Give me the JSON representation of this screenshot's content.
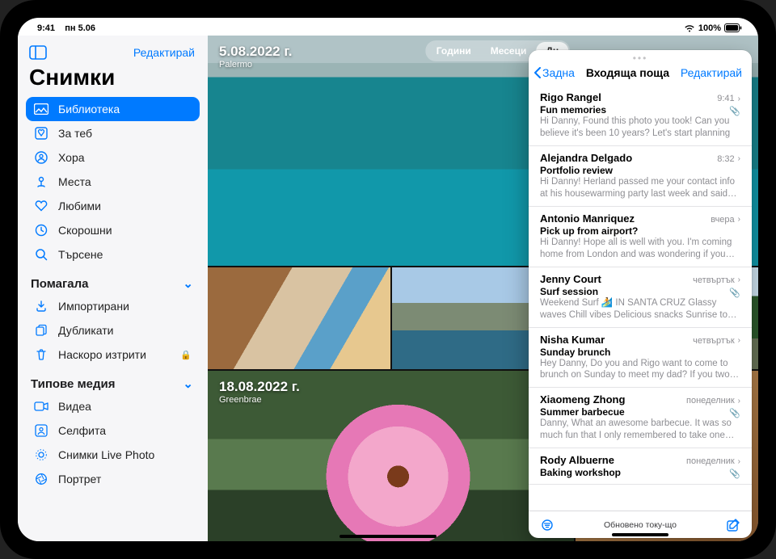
{
  "status": {
    "time": "9:41",
    "date": "пн 5.06",
    "battery": "100%"
  },
  "sidebar": {
    "edit": "Редактирай",
    "title": "Снимки",
    "items": [
      {
        "label": "Библиотека"
      },
      {
        "label": "За теб"
      },
      {
        "label": "Хора"
      },
      {
        "label": "Места"
      },
      {
        "label": "Любими"
      },
      {
        "label": "Скорошни"
      },
      {
        "label": "Търсене"
      }
    ],
    "section_utilities": "Помагала",
    "utilities": [
      {
        "label": "Импортирани"
      },
      {
        "label": "Дубликати"
      },
      {
        "label": "Наскоро изтрити"
      }
    ],
    "section_media": "Типове медия",
    "media": [
      {
        "label": "Видеа"
      },
      {
        "label": "Селфита"
      },
      {
        "label": "Снимки Live Photo"
      },
      {
        "label": "Портрет"
      }
    ]
  },
  "grid": {
    "overlay1": {
      "date": "5.08.2022 г.",
      "loc": "Palermo"
    },
    "overlay2": {
      "date": "18.08.2022 г.",
      "loc": "Greenbrae"
    },
    "segments": {
      "y": "Години",
      "m": "Месеци",
      "d": "Дн"
    }
  },
  "mail": {
    "back": "Задна",
    "title": "Входяща поща",
    "edit": "Редактирай",
    "status": "Обновено току-що",
    "messages": [
      {
        "sender": "Rigo Rangel",
        "date": "9:41",
        "subject": "Fun memories",
        "preview": "Hi Danny, Found this photo you took! Can you believe it's been 10 years? Let's start planning",
        "attach": true
      },
      {
        "sender": "Alejandra Delgado",
        "date": "8:32",
        "subject": "Portfolio review",
        "preview": "Hi Danny! Herland passed me your contact info at his housewarming party last week and said i…",
        "attach": false
      },
      {
        "sender": "Antonio Manriquez",
        "date": "вчера",
        "subject": "Pick up from airport?",
        "preview": "Hi Danny! Hope all is well with you. I'm coming home from London and was wondering if you…",
        "attach": false
      },
      {
        "sender": "Jenny Court",
        "date": "четвъртък",
        "subject": "Surf session",
        "preview": "Weekend Surf 🏄 IN SANTA CRUZ Glassy waves Chill vibes Delicious snacks Sunrise to s…",
        "attach": true
      },
      {
        "sender": "Nisha Kumar",
        "date": "четвъртък",
        "subject": "Sunday brunch",
        "preview": "Hey Danny, Do you and Rigo want to come to brunch on Sunday to meet my dad? If you two…",
        "attach": false
      },
      {
        "sender": "Xiaomeng Zhong",
        "date": "понеделник",
        "subject": "Summer barbecue",
        "preview": "Danny, What an awesome barbecue. It was so much fun that I only remembered to take one…",
        "attach": true
      },
      {
        "sender": "Rody Albuerne",
        "date": "понеделник",
        "subject": "Baking workshop",
        "preview": "",
        "attach": true
      }
    ]
  }
}
